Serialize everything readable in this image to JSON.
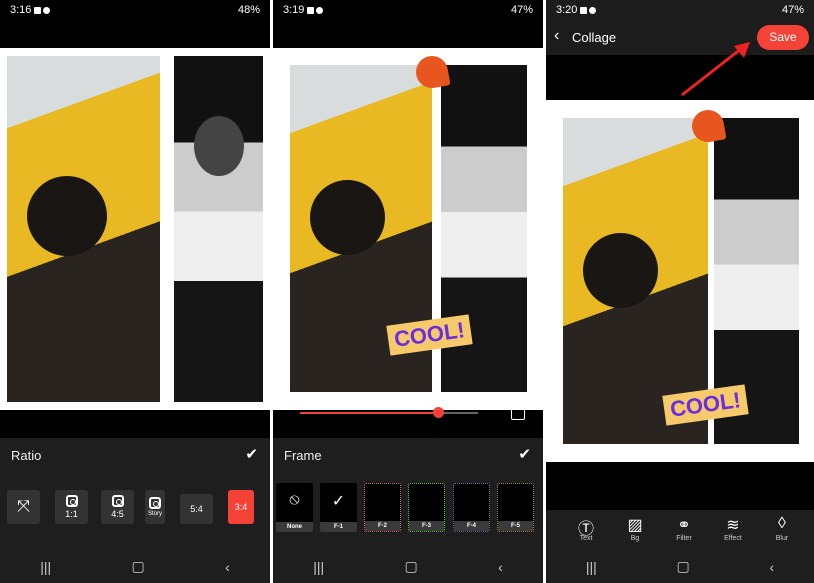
{
  "panels": [
    {
      "status": {
        "time": "3:16",
        "battery": "48%"
      },
      "bottom": {
        "title": "Ratio",
        "ratios": [
          {
            "label": "",
            "icon": "expand-arrows-icon"
          },
          {
            "label": "1:1",
            "icon": "instagram-icon"
          },
          {
            "label": "4:5",
            "icon": "instagram-icon"
          },
          {
            "label": "Story",
            "icon": "instagram-icon"
          },
          {
            "label": "5:4"
          },
          {
            "label": "3:4",
            "selected": true
          }
        ]
      }
    },
    {
      "status": {
        "time": "3:19",
        "battery": "47%"
      },
      "slider": {
        "value_percent": 78
      },
      "bottom": {
        "title": "Frame",
        "frames": [
          {
            "label": "None",
            "icon": "none-circle-icon"
          },
          {
            "label": "F-1",
            "selected": true
          },
          {
            "label": "F-2"
          },
          {
            "label": "F-3"
          },
          {
            "label": "F-4"
          },
          {
            "label": "F-5"
          }
        ]
      },
      "sticker_text": "COOL!"
    },
    {
      "status": {
        "time": "3:20",
        "battery": "47%"
      },
      "header": {
        "title": "Collage",
        "save": "Save"
      },
      "sticker_text": "COOL!",
      "tools": [
        {
          "label": "Text",
          "icon": "text-icon"
        },
        {
          "label": "Bg",
          "icon": "background-icon"
        },
        {
          "label": "Filter",
          "icon": "filter-icon"
        },
        {
          "label": "Effect",
          "icon": "effect-icon"
        },
        {
          "label": "Blur",
          "icon": "blur-drop-icon"
        }
      ]
    }
  ],
  "colors": {
    "accent": "#f44336",
    "panel_bg": "#1e1e1e"
  }
}
